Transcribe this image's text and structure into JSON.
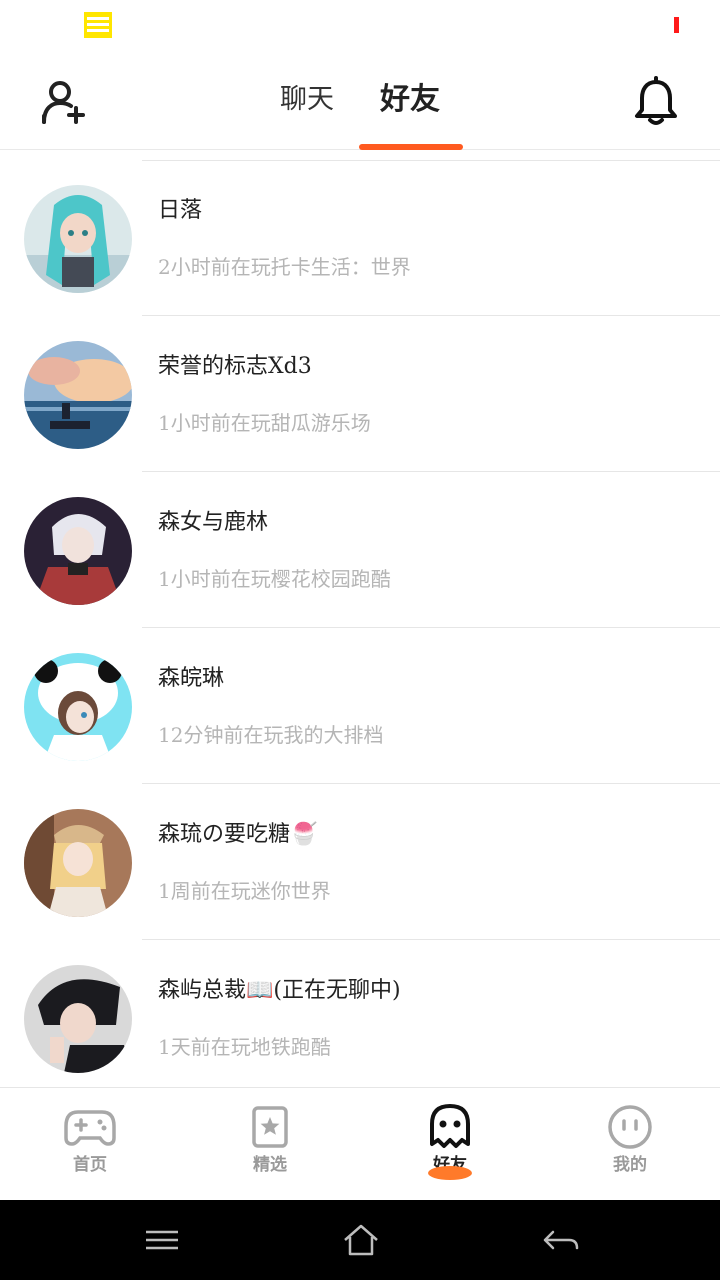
{
  "header": {
    "tabs": [
      {
        "label": "聊天",
        "active": false
      },
      {
        "label": "好友",
        "active": true
      }
    ]
  },
  "friends": [
    {
      "name": "日落",
      "status": "2小时前在玩托卡生活：世界",
      "avatar_colors": [
        "#dbe8ea",
        "#4dc6c9",
        "#f2d7c8"
      ]
    },
    {
      "name": "荣誉的标志Xd3",
      "status": "1小时前在玩甜瓜游乐场",
      "avatar_colors": [
        "#f3c9a3",
        "#7fa7c9",
        "#2d5d86"
      ]
    },
    {
      "name": "森女与鹿林",
      "status": "1小时前在玩樱花校园跑酷",
      "avatar_colors": [
        "#2a2135",
        "#e6e6ee",
        "#a83a3a"
      ]
    },
    {
      "name": "森皖琳",
      "status": "12分钟前在玩我的大排档",
      "avatar_colors": [
        "#7fe3f2",
        "#ffffff",
        "#6b4a3a"
      ]
    },
    {
      "name": "森琉の要吃糖🍧",
      "status": "1周前在玩迷你世界",
      "avatar_colors": [
        "#a7785a",
        "#f1d08a",
        "#efe6dc"
      ]
    },
    {
      "name": "森屿总裁📖(正在无聊中)",
      "status": "1天前在玩地铁跑酷",
      "avatar_colors": [
        "#d9d9d9",
        "#1b1b1f",
        "#f0d8cc"
      ]
    }
  ],
  "bottom_nav": [
    {
      "label": "首页",
      "icon": "gamepad-icon",
      "active": false
    },
    {
      "label": "精选",
      "icon": "star-badge-icon",
      "active": false
    },
    {
      "label": "好友",
      "icon": "ghost-icon",
      "active": true
    },
    {
      "label": "我的",
      "icon": "face-icon",
      "active": false
    }
  ],
  "colors": {
    "accent": "#ff5a1f",
    "muted_text": "#b5b5b5",
    "inactive_nav": "#9a9a9a"
  }
}
